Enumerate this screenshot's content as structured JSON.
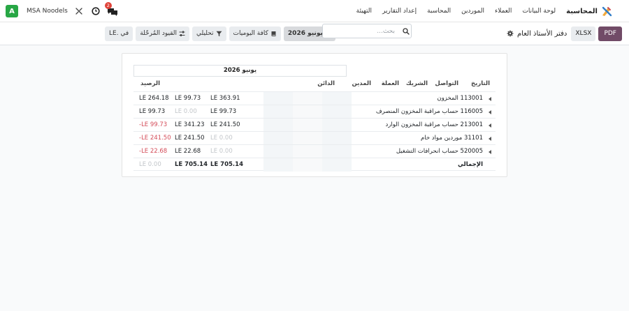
{
  "navbar": {
    "app_name": "المحاسبة",
    "menu": [
      "لوحة البيانات",
      "العملاء",
      "الموردين",
      "المحاسبة",
      "إعداد التقارير",
      "التهيئة"
    ],
    "company": "MSA Noodels",
    "avatar_letter": "A",
    "messages_badge": "2"
  },
  "control_panel": {
    "pdf_label": "PDF",
    "xlsx_label": "XLSX",
    "title": "دفتر الأستاذ العام",
    "search_placeholder": "بحث...",
    "filters": {
      "period": "يونيو 2026",
      "journals": "كافة اليوميات",
      "analytic": "تحليلي",
      "posted": "القيود المُرحّلة",
      "currency": "في .LE"
    }
  },
  "report": {
    "period_header": "يونيو 2026",
    "columns": {
      "date": "التاريخ",
      "communication": "التواصل",
      "partner": "الشريك",
      "currency": "العملة",
      "debit": "المدين",
      "credit": "الدائن",
      "balance": "الرصيد"
    },
    "rows": [
      {
        "account": "113001 المخزون",
        "debit": "LE 363.91",
        "credit": "LE 99.73",
        "balance": "LE 264.18"
      },
      {
        "account": "116005 حساب مراقبة المخزون المنصرف",
        "debit": "LE 99.73",
        "credit": "LE 0.00",
        "balance": "LE 99.73"
      },
      {
        "account": "213001 حساب مراقبة المخزون الوارد",
        "debit": "LE 241.50",
        "credit": "LE 341.23",
        "balance": "-LE 99.73"
      },
      {
        "account": "31101 موردين مواد خام",
        "debit": "LE 0.00",
        "credit": "LE 241.50",
        "balance": "-LE 241.50"
      },
      {
        "account": "520005 حساب انحرافات التشغيل",
        "debit": "LE 0.00",
        "credit": "LE 22.68",
        "balance": "-LE 22.68"
      }
    ],
    "total": {
      "label": "الإجمالي",
      "debit": "LE 705.14",
      "credit": "LE 705.14",
      "balance": "LE 0.00"
    }
  },
  "colors": {
    "brand": "#714b67",
    "avatar": "#28a745",
    "negative": "#d44c59",
    "muted": "#c2c6ca"
  },
  "icons": {
    "app_logo": "accounting-logo-icon",
    "chat": "chat-icon",
    "clock": "clock-icon",
    "tools": "tools-icon",
    "settings": "gear-icon",
    "search": "search-icon"
  }
}
